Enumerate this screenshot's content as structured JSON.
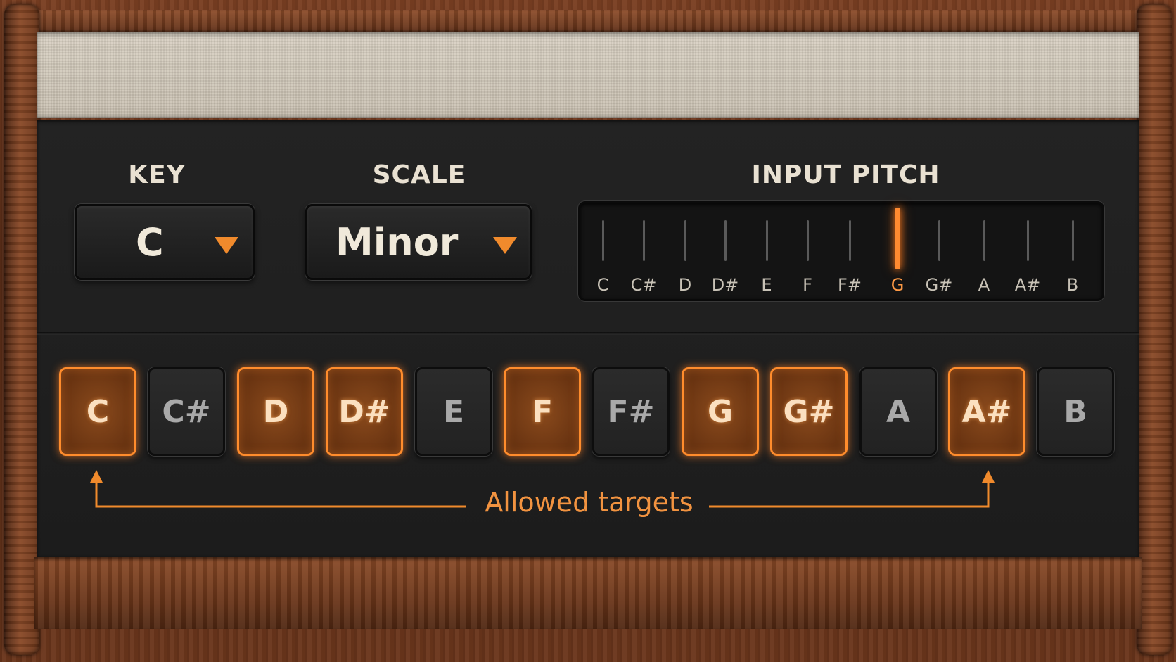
{
  "key": {
    "label": "KEY",
    "value": "C"
  },
  "scale": {
    "label": "SCALE",
    "value": "Minor"
  },
  "input_pitch": {
    "label": "INPUT PITCH",
    "notes": [
      "C",
      "C#",
      "D",
      "D#",
      "E",
      "F",
      "F#",
      "G",
      "G#",
      "A",
      "A#",
      "B"
    ],
    "detected": "G"
  },
  "note_buttons": [
    {
      "label": "C",
      "enabled": true
    },
    {
      "label": "C#",
      "enabled": false
    },
    {
      "label": "D",
      "enabled": true
    },
    {
      "label": "D#",
      "enabled": true
    },
    {
      "label": "E",
      "enabled": false
    },
    {
      "label": "F",
      "enabled": true
    },
    {
      "label": "F#",
      "enabled": false
    },
    {
      "label": "G",
      "enabled": true
    },
    {
      "label": "G#",
      "enabled": true
    },
    {
      "label": "A",
      "enabled": false
    },
    {
      "label": "A#",
      "enabled": true
    },
    {
      "label": "B",
      "enabled": false
    }
  ],
  "caption": "Allowed targets",
  "colors": {
    "accent": "#ff8c2c",
    "panel": "#1f1f1f",
    "wood": "#6b361c",
    "grille": "#d2c9ba"
  }
}
